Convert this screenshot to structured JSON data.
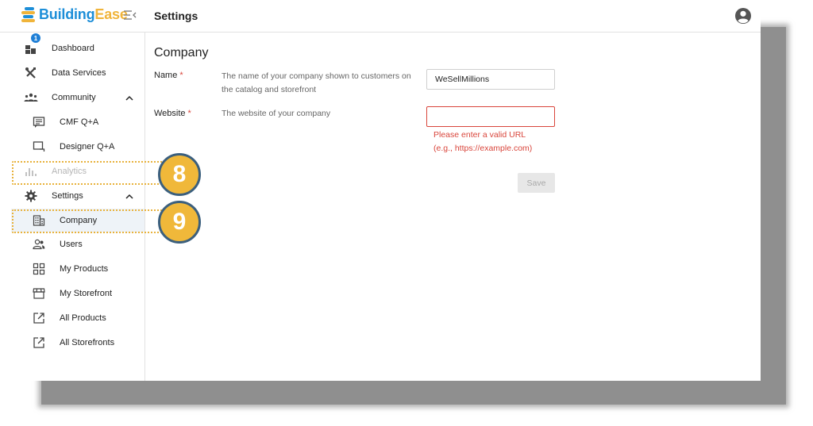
{
  "brand": {
    "name_part1": "Building",
    "name_part2": "Ease"
  },
  "header": {
    "title": "Settings"
  },
  "sidebar": {
    "dashboard": {
      "label": "Dashboard",
      "badge": "1"
    },
    "data_services": {
      "label": "Data Services"
    },
    "community": {
      "label": "Community",
      "expanded": true
    },
    "cmf_qa": {
      "label": "CMF Q+A"
    },
    "designer_qa": {
      "label": "Designer Q+A"
    },
    "analytics": {
      "label": "Analytics",
      "disabled": true
    },
    "settings": {
      "label": "Settings",
      "expanded": true
    },
    "company": {
      "label": "Company",
      "active": true
    },
    "users": {
      "label": "Users"
    },
    "my_products": {
      "label": "My Products"
    },
    "my_storefront": {
      "label": "My Storefront"
    },
    "all_products": {
      "label": "All Products"
    },
    "all_storefronts": {
      "label": "All Storefronts"
    }
  },
  "callouts": {
    "first": "8",
    "second": "9"
  },
  "main": {
    "section_title": "Company",
    "name_field": {
      "label": "Name",
      "required_mark": "*",
      "description": "The name of your company shown to customers on the catalog and storefront",
      "value": "WeSellMillions"
    },
    "website_field": {
      "label": "Website",
      "required_mark": "*",
      "description": "The website of your company",
      "value": "",
      "error_line1": "Please enter a valid URL",
      "error_line2": "(e.g., https://example.com)"
    },
    "save_label": "Save"
  },
  "colors": {
    "brand_blue": "#1d8ed8",
    "brand_yellow": "#f0b43a",
    "error_red": "#d9453b",
    "callout_fill": "#f0b83a",
    "callout_border": "#3b5f7d"
  }
}
